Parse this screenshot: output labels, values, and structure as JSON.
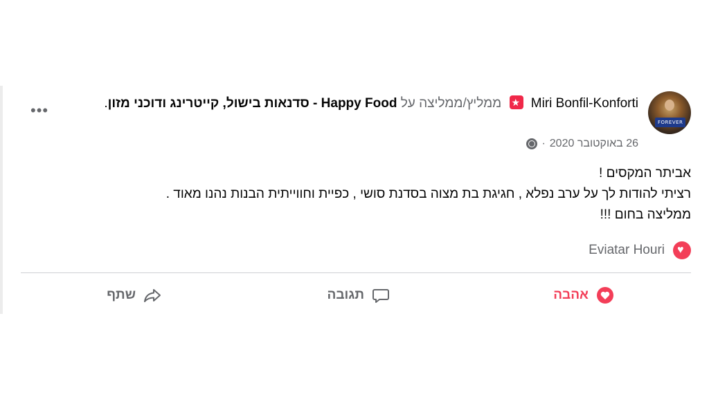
{
  "post": {
    "author": "Miri Bonfil-Konforti",
    "recommends_text": "ממליץ/ממליצה על",
    "page_name": "Happy Food - סדנאות בישול, קייטרינג ודוכני מזון",
    "page_suffix": ".",
    "date": "26 באוקטובר 2020",
    "separator": "·",
    "avatar_banner": "FOREVER",
    "body_lines": [
      "אביתר המקסים !",
      "רציתי להודות לך על ערב נפלא , חגיגת בת מצוה בסדנת סושי , כפיית וחווייתית הבנות נהנו מאוד .",
      "ממליצה בחום !!!"
    ],
    "reactor": "Eviatar Houri",
    "more_label": "•••"
  },
  "actions": {
    "love": "אהבה",
    "comment": "תגובה",
    "share": "שתף"
  },
  "colors": {
    "love": "#f33e58",
    "secondary_text": "#65676b",
    "divider": "#ced0d4"
  },
  "icons": {
    "avatar": "profile-photo",
    "badge": "recommend-star-icon",
    "globe": "globe-icon",
    "more": "more-options-icon",
    "heart": "heart-icon",
    "comment": "comment-bubble-icon",
    "share": "share-arrow-icon"
  }
}
